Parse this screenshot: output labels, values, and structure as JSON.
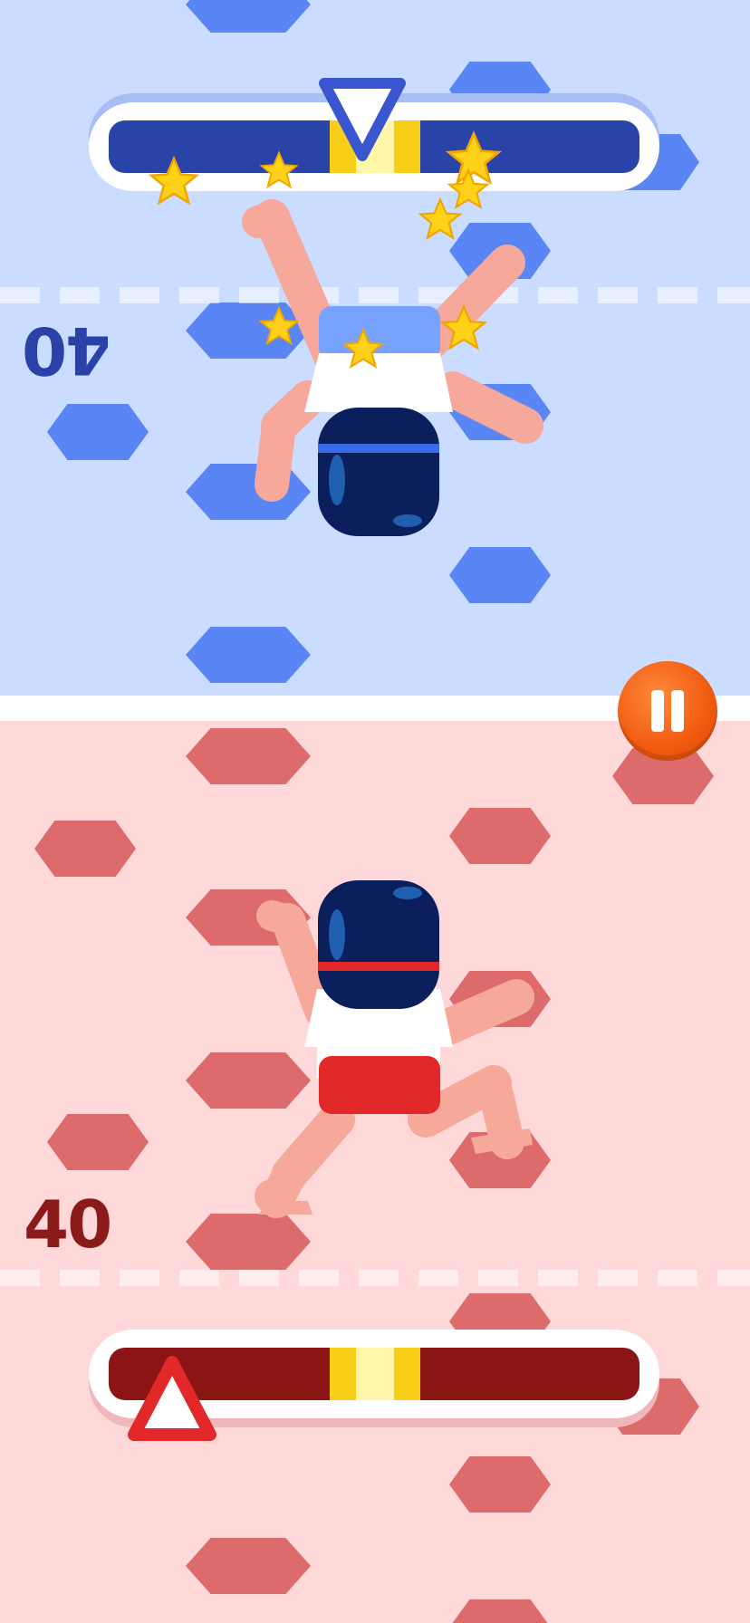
{
  "players": {
    "top": {
      "score": "40",
      "color": "#2a42a8",
      "meter_marker_position": 0.42,
      "facing": "down"
    },
    "bottom": {
      "score": "40",
      "color": "#8b1a1a",
      "meter_marker_position": 0.11,
      "facing": "up"
    }
  },
  "colors": {
    "top_background": "#cadcff",
    "bottom_background": "#ffd8da",
    "blue_hold": "#5a86f5",
    "red_hold": "#dd6b6b",
    "meter_target_zone": "#f7cf18",
    "pause_button": "#f05a10"
  },
  "icons": {
    "pause": "pause-icon",
    "top_marker": "triangle-down-icon",
    "bottom_marker": "triangle-up-icon",
    "stars": "star-icon"
  }
}
